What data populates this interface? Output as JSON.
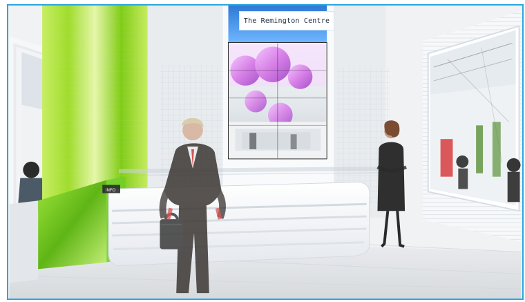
{
  "scene": {
    "screen_title": "The Remington Centre",
    "desk_sign": "INFO"
  },
  "colors": {
    "frame_border": "#2aa6df",
    "green_panel": "#7ccc1f",
    "lime_curtain": "#b8e84a",
    "screen_blue": "#3a8fe0",
    "magenta_art": "#d67be6",
    "suit_dark": "#3b3633",
    "tie_red": "#d33a3a",
    "floor": "#e6e7e9",
    "desk": "#f8f9fb"
  }
}
